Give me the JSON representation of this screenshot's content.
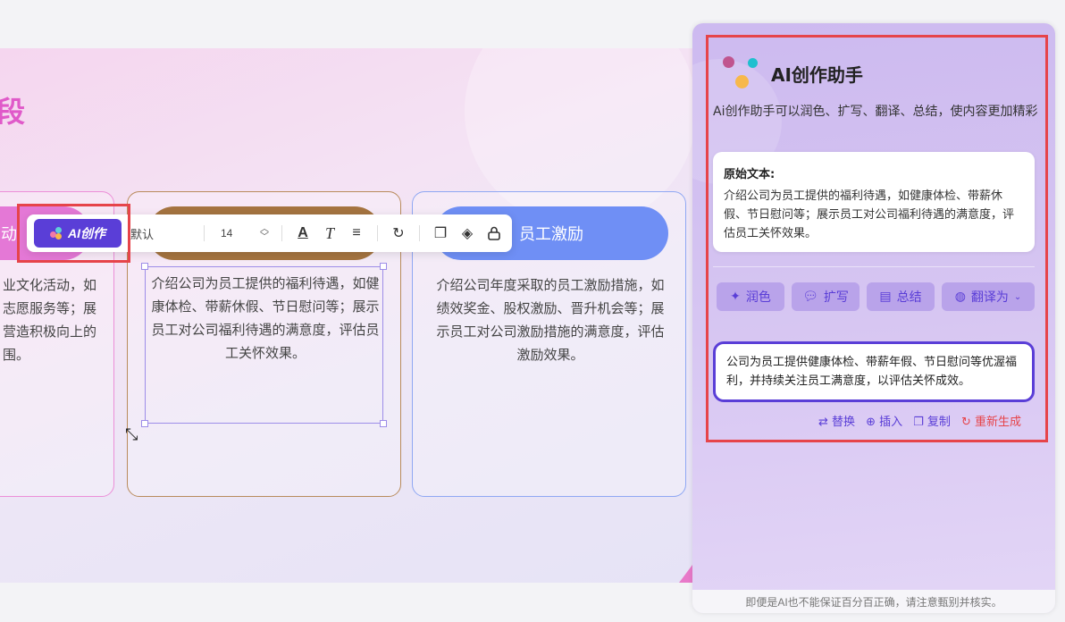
{
  "slide": {
    "title_fragment": "段",
    "cards": [
      {
        "header": "动",
        "text": "业文化活动，如\n志愿服务等；展\n营造积极向上的\n围。"
      },
      {
        "header": "",
        "text": "介绍公司为员工提供的福利待遇，如健康体检、带薪休假、节日慰问等；展示员工对公司福利待遇的满意度，评估员工关怀效果。"
      },
      {
        "header": "员工激励",
        "text": "介绍公司年度采取的员工激励措施，如绩效奖金、股权激励、晋升机会等；展示员工对公司激励措施的满意度，评估激励效果。"
      }
    ]
  },
  "toolbar": {
    "ai_button_label": "AI创作",
    "font_name": "默认",
    "font_size": "14",
    "icons": [
      "font-color-icon",
      "italic-icon",
      "align-icon",
      "rotate-icon",
      "copy-icon",
      "layers-icon",
      "lock-icon"
    ]
  },
  "panel": {
    "title": "AI创作助手",
    "description": "Ai创作助手可以润色、扩写、翻译、总结，使内容更加精彩",
    "original_label": "原始文本:",
    "original_text": "介绍公司为员工提供的福利待遇，如健康体检、带薪休假、节日慰问等；展示员工对公司福利待遇的满意度，评估员工关怀效果。",
    "actions": {
      "polish": "润色",
      "expand": "扩写",
      "summarize": "总结",
      "translate": "翻译为"
    },
    "result_text": "公司为员工提供健康体检、带薪年假、节日慰问等优渥福利，并持续关注员工满意度，以评估关怀成效。",
    "result_actions": {
      "replace": "替换",
      "insert": "插入",
      "copy": "复制",
      "regenerate": "重新生成"
    },
    "footer": "即便是AI也不能保证百分百正确，请注意甄别并核实。"
  },
  "colors": {
    "accent": "#5a3ed7",
    "highlight_frame": "#e6444a",
    "card1": "#e478d6",
    "card2": "#a57440",
    "card3": "#6f8ff5"
  }
}
